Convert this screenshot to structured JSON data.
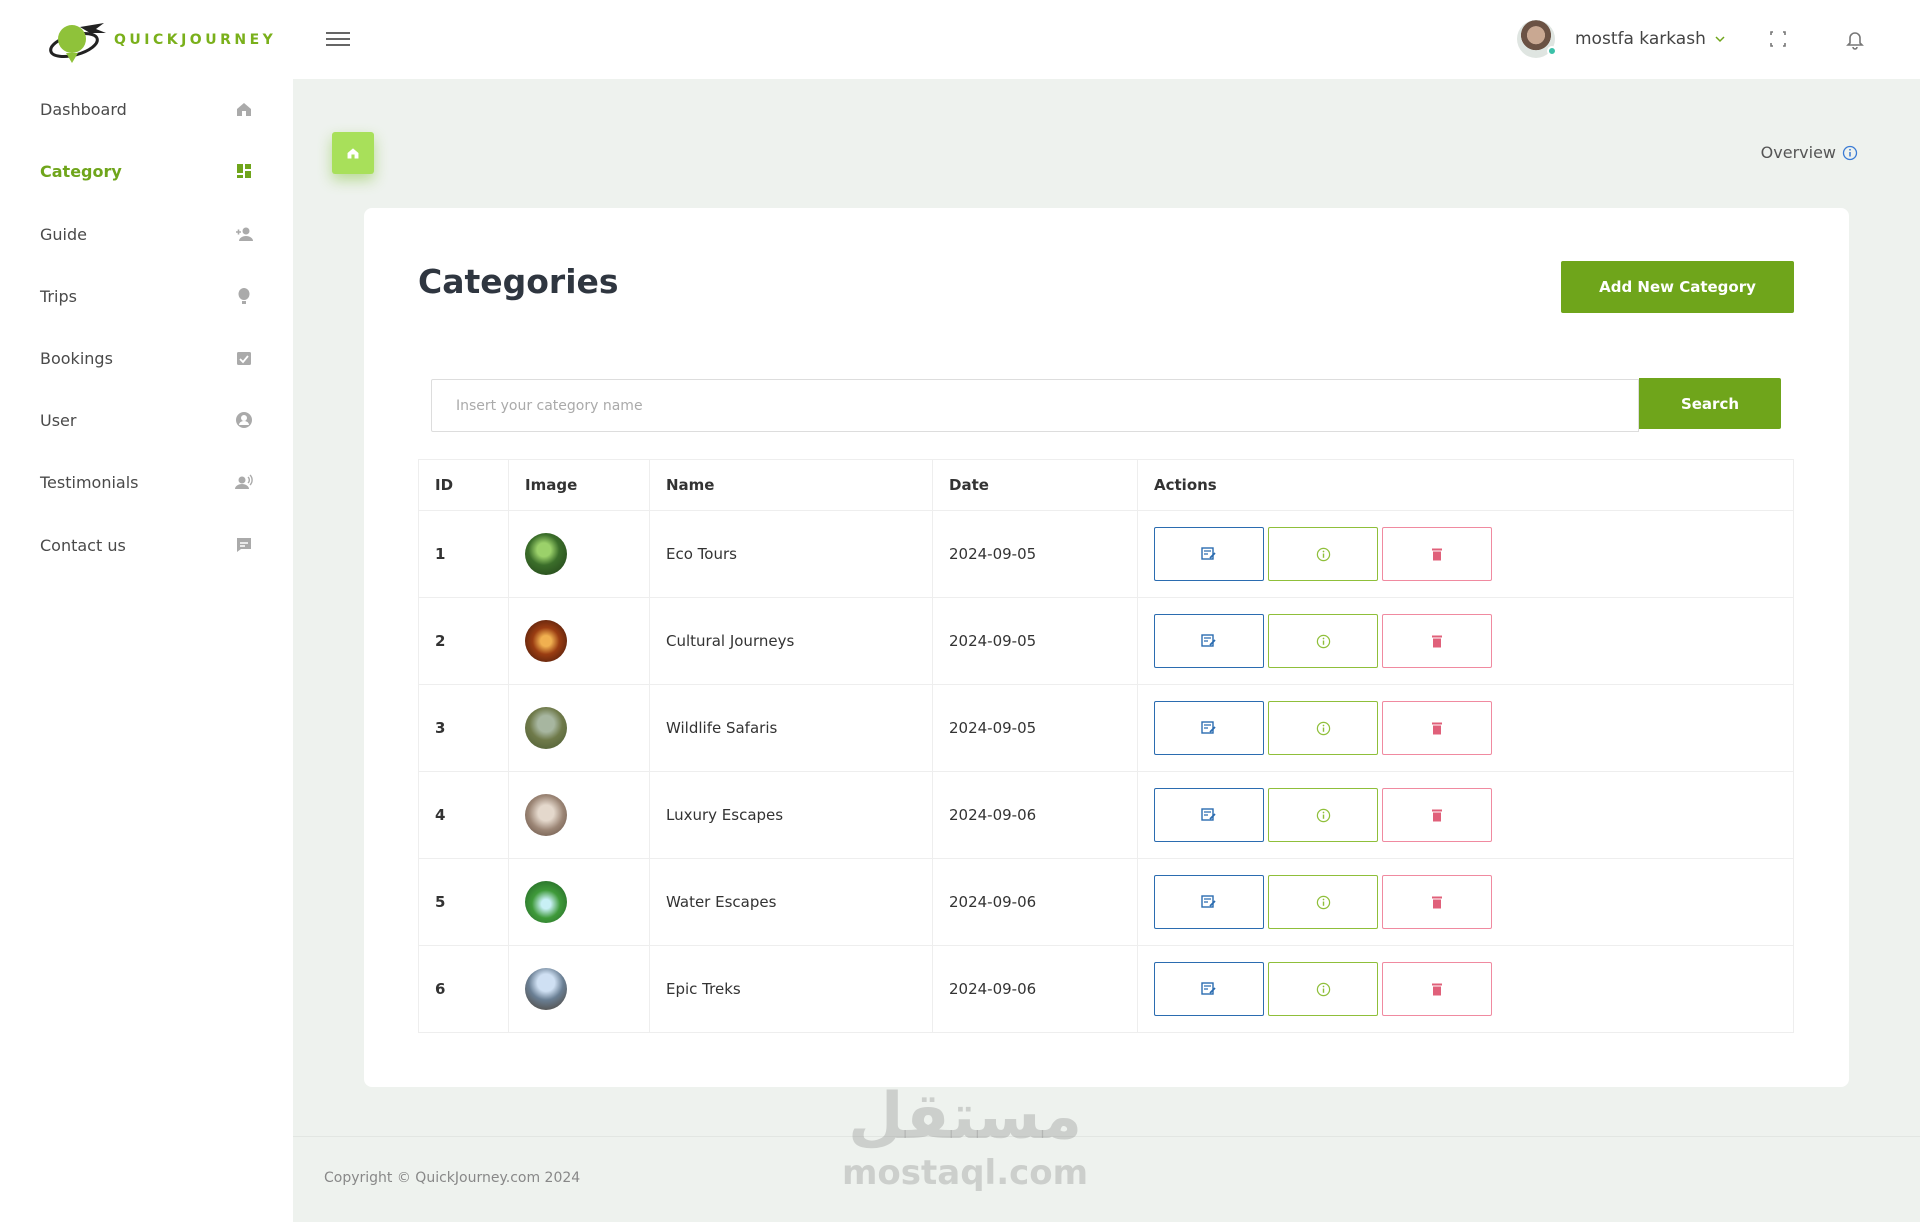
{
  "header": {
    "logo_text": "QUICKJOURNEY",
    "user_name": "mostfa karkash"
  },
  "sidebar": {
    "items": [
      {
        "label": "Dashboard",
        "icon": "home-icon"
      },
      {
        "label": "Category",
        "icon": "grid-icon",
        "active": true
      },
      {
        "label": "Guide",
        "icon": "user-plus-icon"
      },
      {
        "label": "Trips",
        "icon": "balloon-icon"
      },
      {
        "label": "Bookings",
        "icon": "calendar-check-icon"
      },
      {
        "label": "User",
        "icon": "user-circle-icon"
      },
      {
        "label": "Testimonials",
        "icon": "user-voice-icon"
      },
      {
        "label": "Contact us",
        "icon": "chat-icon"
      }
    ]
  },
  "main": {
    "overview_label": "Overview",
    "title": "Categories",
    "add_button": "Add New Category",
    "search": {
      "placeholder": "Insert your category name",
      "button": "Search"
    },
    "table": {
      "columns": [
        "ID",
        "Image",
        "Name",
        "Date",
        "Actions"
      ],
      "rows": [
        {
          "id": "1",
          "name": "Eco Tours",
          "date": "2024-09-05"
        },
        {
          "id": "2",
          "name": "Cultural Journeys",
          "date": "2024-09-05"
        },
        {
          "id": "3",
          "name": "Wildlife Safaris",
          "date": "2024-09-05"
        },
        {
          "id": "4",
          "name": "Luxury Escapes",
          "date": "2024-09-06"
        },
        {
          "id": "5",
          "name": "Water Escapes",
          "date": "2024-09-06"
        },
        {
          "id": "6",
          "name": "Epic Treks",
          "date": "2024-09-06"
        }
      ]
    }
  },
  "footer": {
    "copyright": "Copyright © QuickJourney.com 2024"
  },
  "watermark": {
    "arabic": "مستقل",
    "latin": "mostaql.com"
  },
  "colors": {
    "accent": "#6fa51b",
    "edit": "#2b6cb0",
    "info": "#8fbf3a",
    "delete": "#e0607a"
  }
}
